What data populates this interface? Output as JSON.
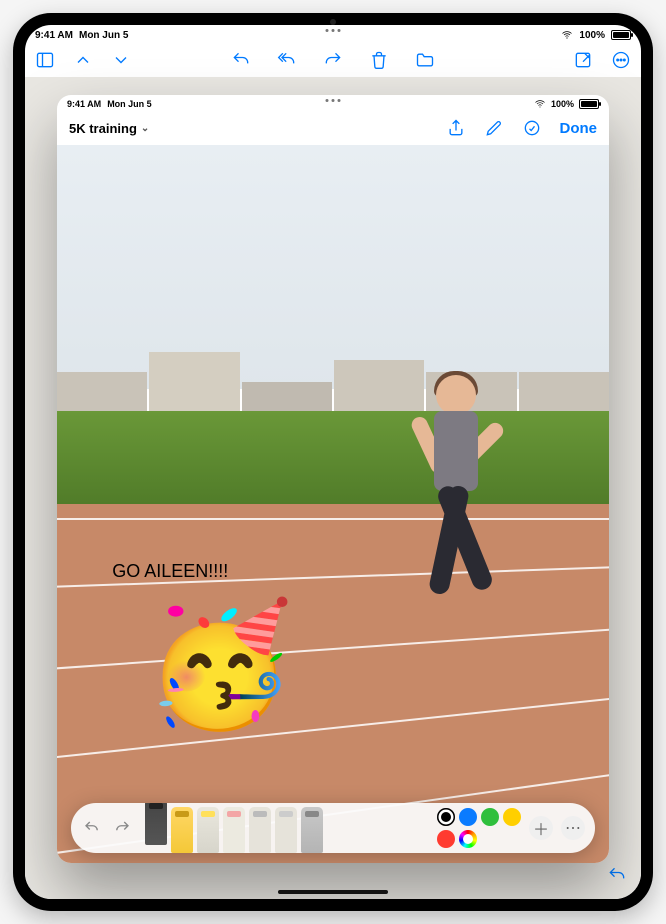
{
  "outer_status": {
    "time": "9:41 AM",
    "date": "Mon Jun 5",
    "battery_pct": "100%"
  },
  "sheet_status": {
    "time": "9:41 AM",
    "date": "Mon Jun 5",
    "battery_pct": "100%"
  },
  "sheet": {
    "doc_title": "5K training",
    "done_label": "Done"
  },
  "annotation": {
    "text": "GO AILEEN!!!!",
    "emoji": "🥳"
  },
  "markup_tools": [
    {
      "name": "pen",
      "selected": true
    },
    {
      "name": "marker",
      "selected": false
    },
    {
      "name": "highlighter",
      "selected": false
    },
    {
      "name": "eraser",
      "selected": false
    },
    {
      "name": "lasso",
      "selected": false
    },
    {
      "name": "ruler",
      "selected": false
    },
    {
      "name": "pencil",
      "selected": false
    }
  ],
  "swatches": {
    "current": "#000000",
    "palette": [
      "#000000",
      "#0a7bff",
      "#2fbf3d",
      "#ffcf00",
      "#ff3b30"
    ]
  },
  "outer_toolbar": {
    "left": [
      "sidebar-icon",
      "chevron-up-icon",
      "chevron-down-icon"
    ],
    "center": [
      "undo-icon",
      "reply-all-icon",
      "forward-icon",
      "trash-icon",
      "folder-icon"
    ],
    "right": [
      "compose-icon",
      "more-icon"
    ]
  }
}
